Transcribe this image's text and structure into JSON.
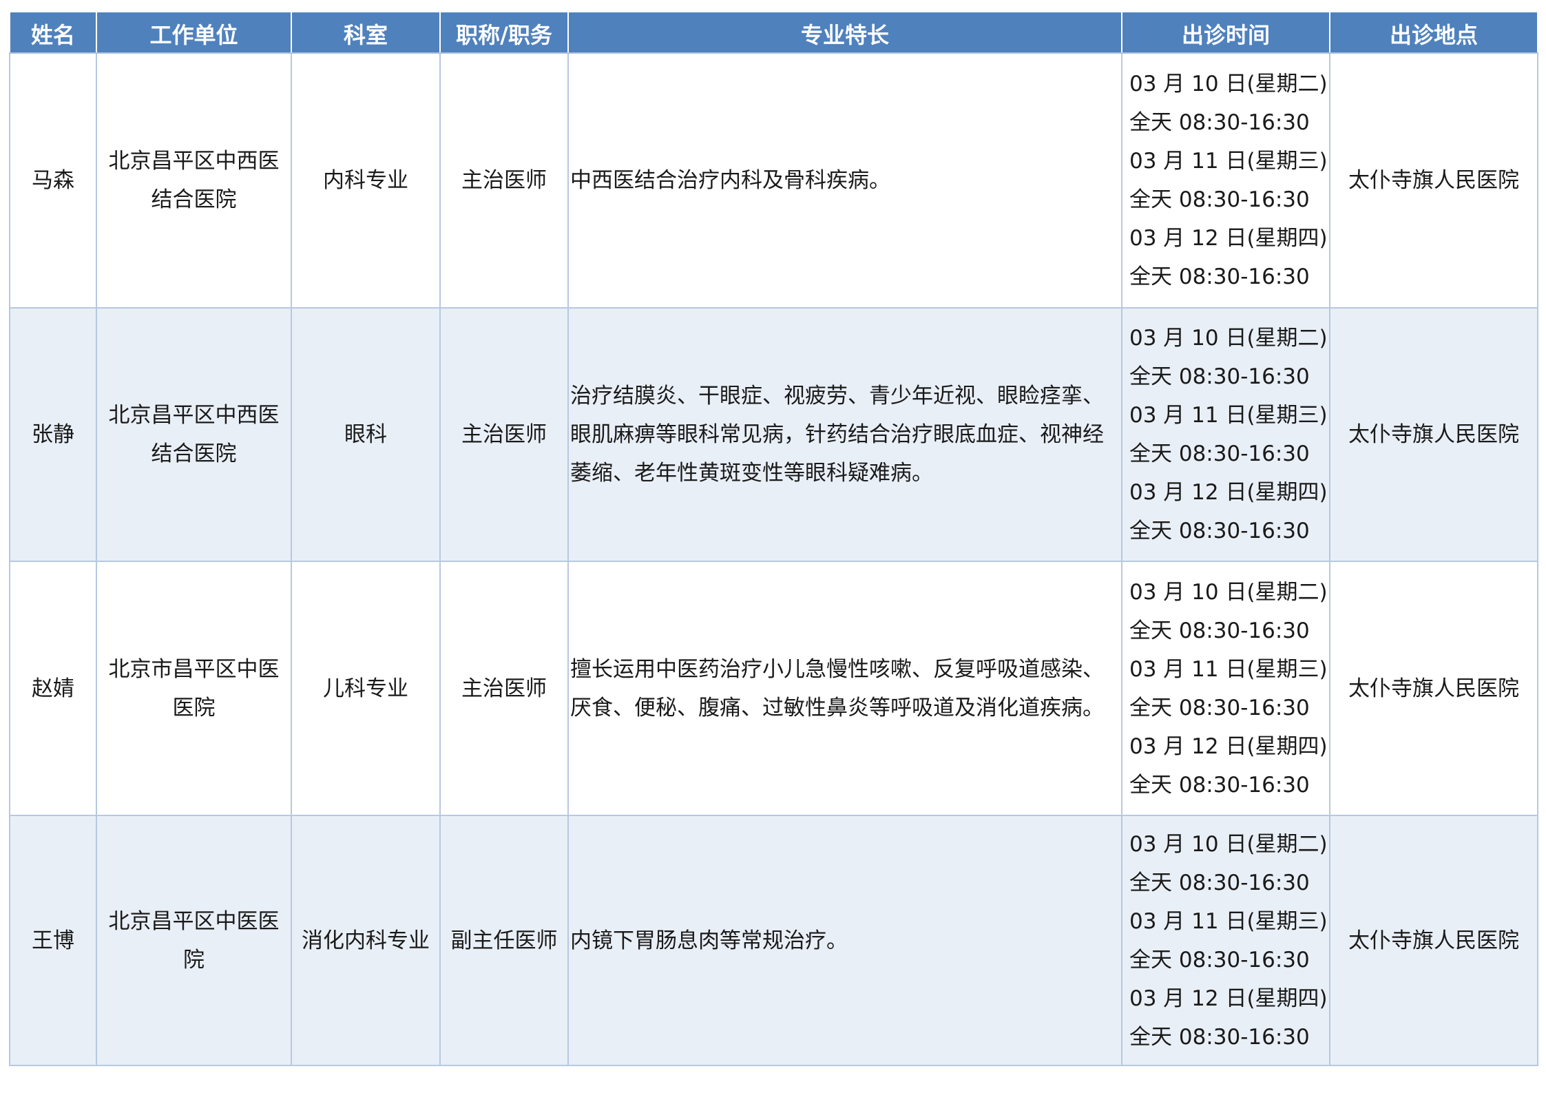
{
  "table": {
    "headers": {
      "name": "姓名",
      "unit": "工作单位",
      "dept": "科室",
      "title": "职称/职务",
      "specialty": "专业特长",
      "time": "出诊时间",
      "place": "出诊地点"
    },
    "rows": [
      {
        "name": "马森",
        "unit": "北京昌平区中西医结合医院",
        "dept": "内科专业",
        "title": "主治医师",
        "specialty": "中西医结合治疗内科及骨科疾病。",
        "times": [
          "03 月 10 日(星期二)",
          "全天 08:30-16:30",
          "03 月 11 日(星期三)",
          "全天 08:30-16:30",
          "03 月 12 日(星期四)",
          "全天 08:30-16:30"
        ],
        "place": "太仆寺旗人民医院"
      },
      {
        "name": "张静",
        "unit": "北京昌平区中西医结合医院",
        "dept": "眼科",
        "title": "主治医师",
        "specialty": "治疗结膜炎、干眼症、视疲劳、青少年近视、眼睑痉挛、眼肌麻痹等眼科常见病，针药结合治疗眼底血症、视神经萎缩、老年性黄斑变性等眼科疑难病。",
        "times": [
          "03 月 10 日(星期二)",
          "全天 08:30-16:30",
          "03 月 11 日(星期三)",
          "全天 08:30-16:30",
          "03 月 12 日(星期四)",
          "全天 08:30-16:30"
        ],
        "place": "太仆寺旗人民医院"
      },
      {
        "name": "赵婧",
        "unit": "北京市昌平区中医医院",
        "dept": "儿科专业",
        "title": "主治医师",
        "specialty": "擅长运用中医药治疗小儿急慢性咳嗽、反复呼吸道感染、厌食、便秘、腹痛、过敏性鼻炎等呼吸道及消化道疾病。",
        "times": [
          "03 月 10 日(星期二)",
          "全天 08:30-16:30",
          "03 月 11 日(星期三)",
          "全天 08:30-16:30",
          "03 月 12 日(星期四)",
          "全天 08:30-16:30"
        ],
        "place": "太仆寺旗人民医院"
      },
      {
        "name": "王博",
        "unit": "北京昌平区中医医院",
        "dept": "消化内科专业",
        "title": "副主任医师",
        "specialty": "内镜下胃肠息肉等常规治疗。",
        "times": [
          "03 月 10 日(星期二)",
          "全天 08:30-16:30",
          "03 月 11 日(星期三)",
          "全天 08:30-16:30",
          "03 月 12 日(星期四)",
          "全天 08:30-16:30"
        ],
        "place": "太仆寺旗人民医院"
      }
    ]
  },
  "colors": {
    "header_bg": "#4f81bd",
    "header_text": "#ffffff",
    "row_alt_bg": "#e9eff7",
    "border": "#b6c8e2"
  }
}
